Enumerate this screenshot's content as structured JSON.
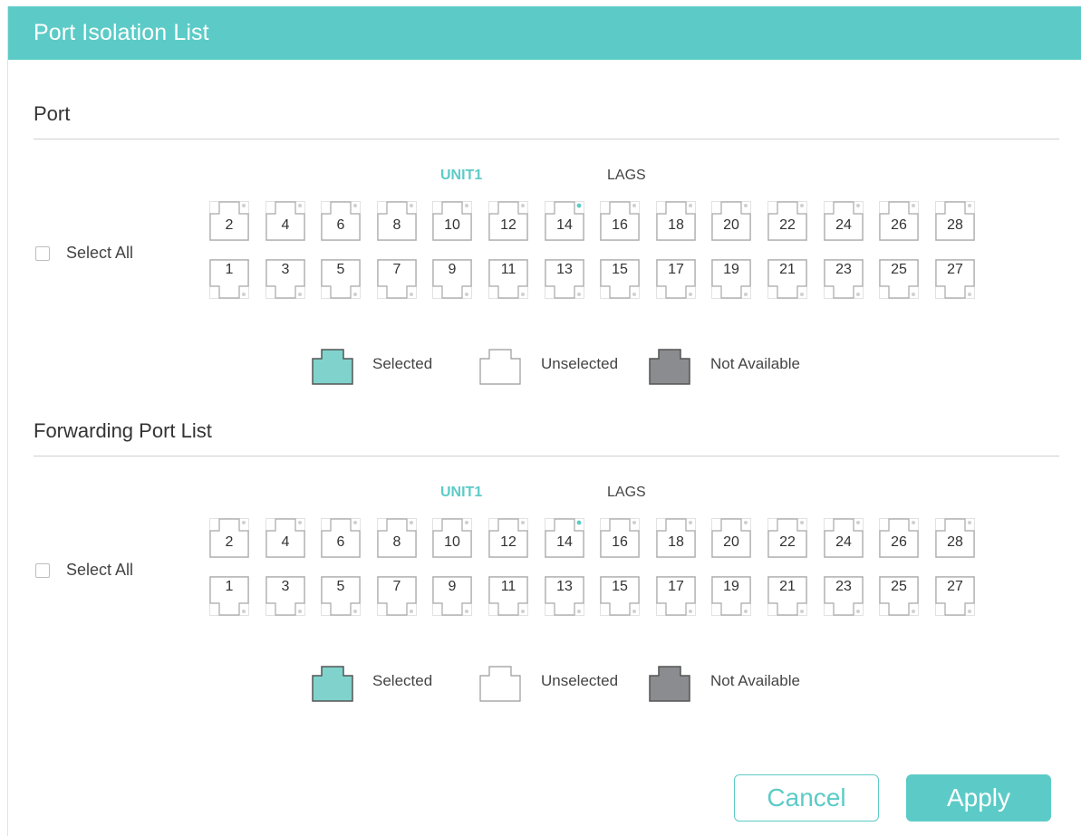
{
  "header": {
    "title": "Port Isolation List"
  },
  "sections": [
    {
      "title": "Port",
      "select_all_label": "Select All",
      "unit_label": "UNIT1",
      "lags_label": "LAGS",
      "top_ports": [
        "2",
        "4",
        "6",
        "8",
        "10",
        "12",
        "14",
        "16",
        "18",
        "20",
        "22",
        "24",
        "26",
        "28"
      ],
      "bottom_ports": [
        "1",
        "3",
        "5",
        "7",
        "9",
        "11",
        "13",
        "15",
        "17",
        "19",
        "21",
        "23",
        "25",
        "27"
      ],
      "active_port": "14",
      "legend": {
        "selected": "Selected",
        "unselected": "Unselected",
        "not_available": "Not Available"
      }
    },
    {
      "title": "Forwarding Port List",
      "select_all_label": "Select All",
      "unit_label": "UNIT1",
      "lags_label": "LAGS",
      "top_ports": [
        "2",
        "4",
        "6",
        "8",
        "10",
        "12",
        "14",
        "16",
        "18",
        "20",
        "22",
        "24",
        "26",
        "28"
      ],
      "bottom_ports": [
        "1",
        "3",
        "5",
        "7",
        "9",
        "11",
        "13",
        "15",
        "17",
        "19",
        "21",
        "23",
        "25",
        "27"
      ],
      "active_port": "14",
      "legend": {
        "selected": "Selected",
        "unselected": "Unselected",
        "not_available": "Not Available"
      }
    }
  ],
  "buttons": {
    "cancel": "Cancel",
    "apply": "Apply"
  },
  "colors": {
    "accent": "#5ccbc7",
    "selected_fill": "#7fd3cc",
    "not_available_fill": "#8a8c8f"
  }
}
